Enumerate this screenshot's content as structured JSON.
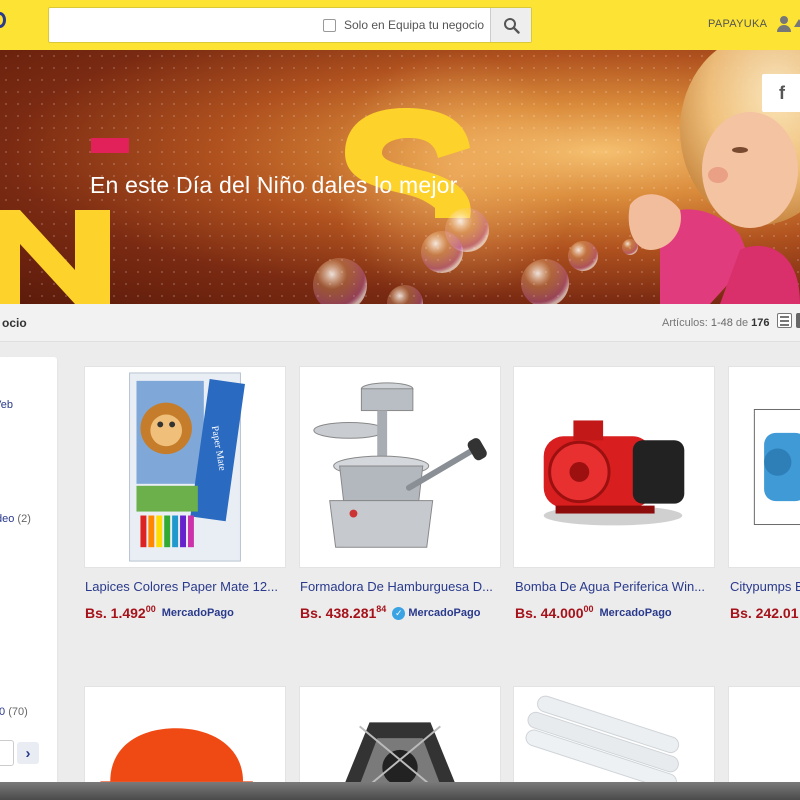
{
  "header": {
    "search_placeholder": "",
    "store_filter_label": "Solo en Equipa tu negocio",
    "username": "PAPAYUKA"
  },
  "banner": {
    "tagline": "En este Día del Niño dales lo mejor",
    "facebook_glyph": "f"
  },
  "toolbar": {
    "store_name": "ocio",
    "results_label": "Artículos:",
    "results_range": "1-48",
    "results_of": "de",
    "results_total": "176"
  },
  "sidebar": {
    "link_1": "Veb",
    "link_2": "deo",
    "link_2_count": "(2)",
    "link_3": "0",
    "link_3_count": "(70)",
    "go_glyph": "›"
  },
  "products": [
    {
      "title": "Lapices Colores Paper Mate 12...",
      "price": "Bs. 1.492",
      "cents": "00",
      "payment": "MercadoPago",
      "verified": false
    },
    {
      "title": "Formadora De Hamburguesa D...",
      "price": "Bs. 438.281",
      "cents": "84",
      "payment": "MercadoPago",
      "verified": true
    },
    {
      "title": "Bomba De Agua Periferica Win...",
      "price": "Bs. 44.000",
      "cents": "00",
      "payment": "MercadoPago",
      "verified": false
    },
    {
      "title": "Citypumps B",
      "price": "Bs. 242.01",
      "cents": "",
      "payment": "",
      "verified": false
    }
  ],
  "icons": {
    "search": "search-icon",
    "user": "user-icon",
    "facebook": "facebook-icon",
    "list_view": "list-view-icon",
    "grid_view": "grid-view-icon",
    "arrow": "chevron-right-icon"
  },
  "colors": {
    "header_bg": "#fde434",
    "link": "#2a3a8c",
    "price": "#a5121a",
    "accent": "#e2205a"
  }
}
